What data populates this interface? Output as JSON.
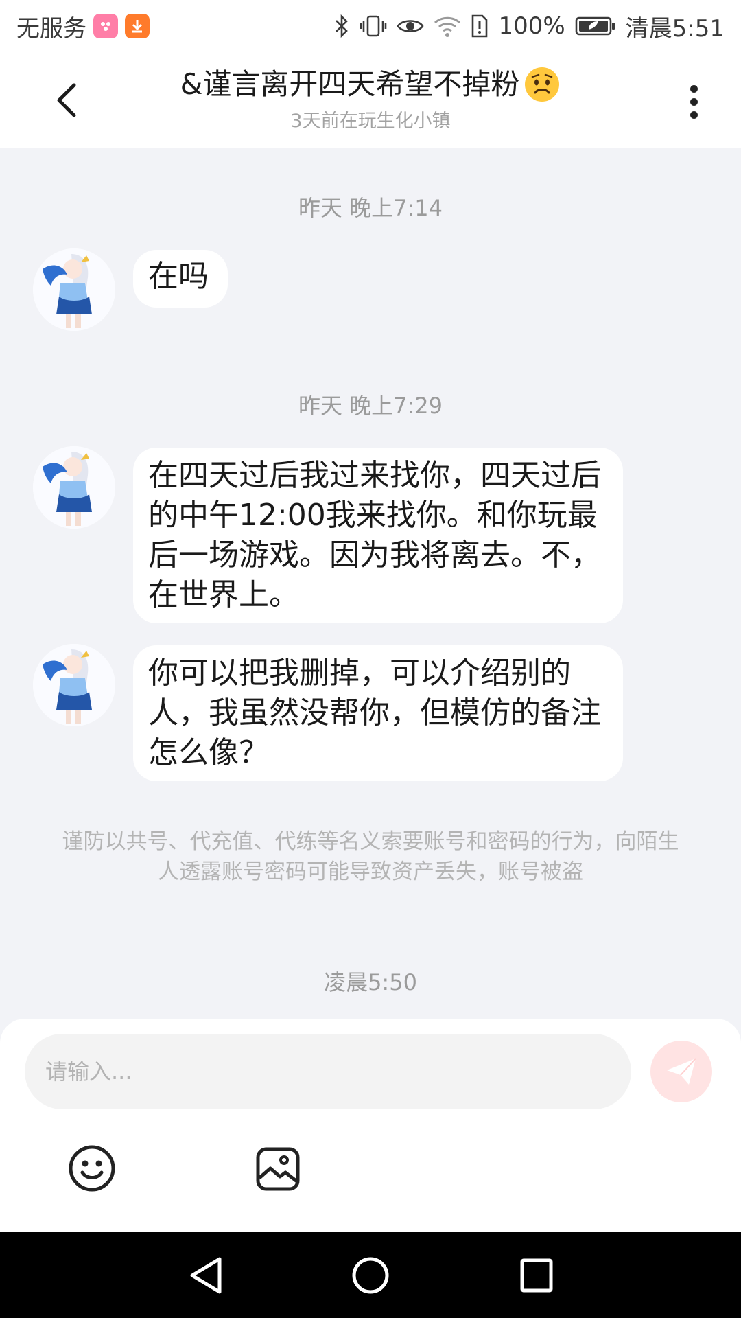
{
  "status_bar": {
    "carrier": "无服务",
    "battery": "100%",
    "time": "清晨5:51",
    "icons": [
      "app-badge-icon",
      "download-badge-icon",
      "bluetooth-icon",
      "vibrate-icon",
      "eye-icon",
      "wifi-icon",
      "sim-alert-icon",
      "battery-icon"
    ]
  },
  "header": {
    "title": "&谨言离开四天希望不掉粉",
    "title_emoji": "worried-face-icon",
    "subtitle": "3天前在玩生化小镇",
    "back_icon": "chevron-left-icon",
    "more_icon": "more-vertical-icon"
  },
  "chat": {
    "messages": [
      {
        "timestamp": "昨天 晚上7:14",
        "text": "在吗"
      },
      {
        "timestamp": "昨天 晚上7:29",
        "text": "在四天过后我过来找你，四天过后的中午12:00我来找你。和你玩最后一场游戏。因为我将离去。不，在世界上。"
      },
      {
        "timestamp": "",
        "text": "你可以把我删掉，可以介绍别的人，我虽然没帮你，但模仿的备注怎么像？"
      }
    ],
    "notice": "谨防以共号、代充值、代练等名义索要账号和密码的行为，向陌生人透露账号密码可能导致资产丢失，账号被盗",
    "last_timestamp": "凌晨5:50"
  },
  "input": {
    "placeholder": "请输入...",
    "value": "",
    "send_icon": "send-icon",
    "emoji_icon": "smiley-icon",
    "image_icon": "image-icon"
  },
  "nav_bar": {
    "icons": [
      "nav-back-icon",
      "nav-home-icon",
      "nav-recents-icon"
    ]
  },
  "colors": {
    "chat_background": "#f2f3f7",
    "bubble": "#ffffff",
    "send_button": "#ffe3e3",
    "send_arrow": "#ffffff"
  }
}
